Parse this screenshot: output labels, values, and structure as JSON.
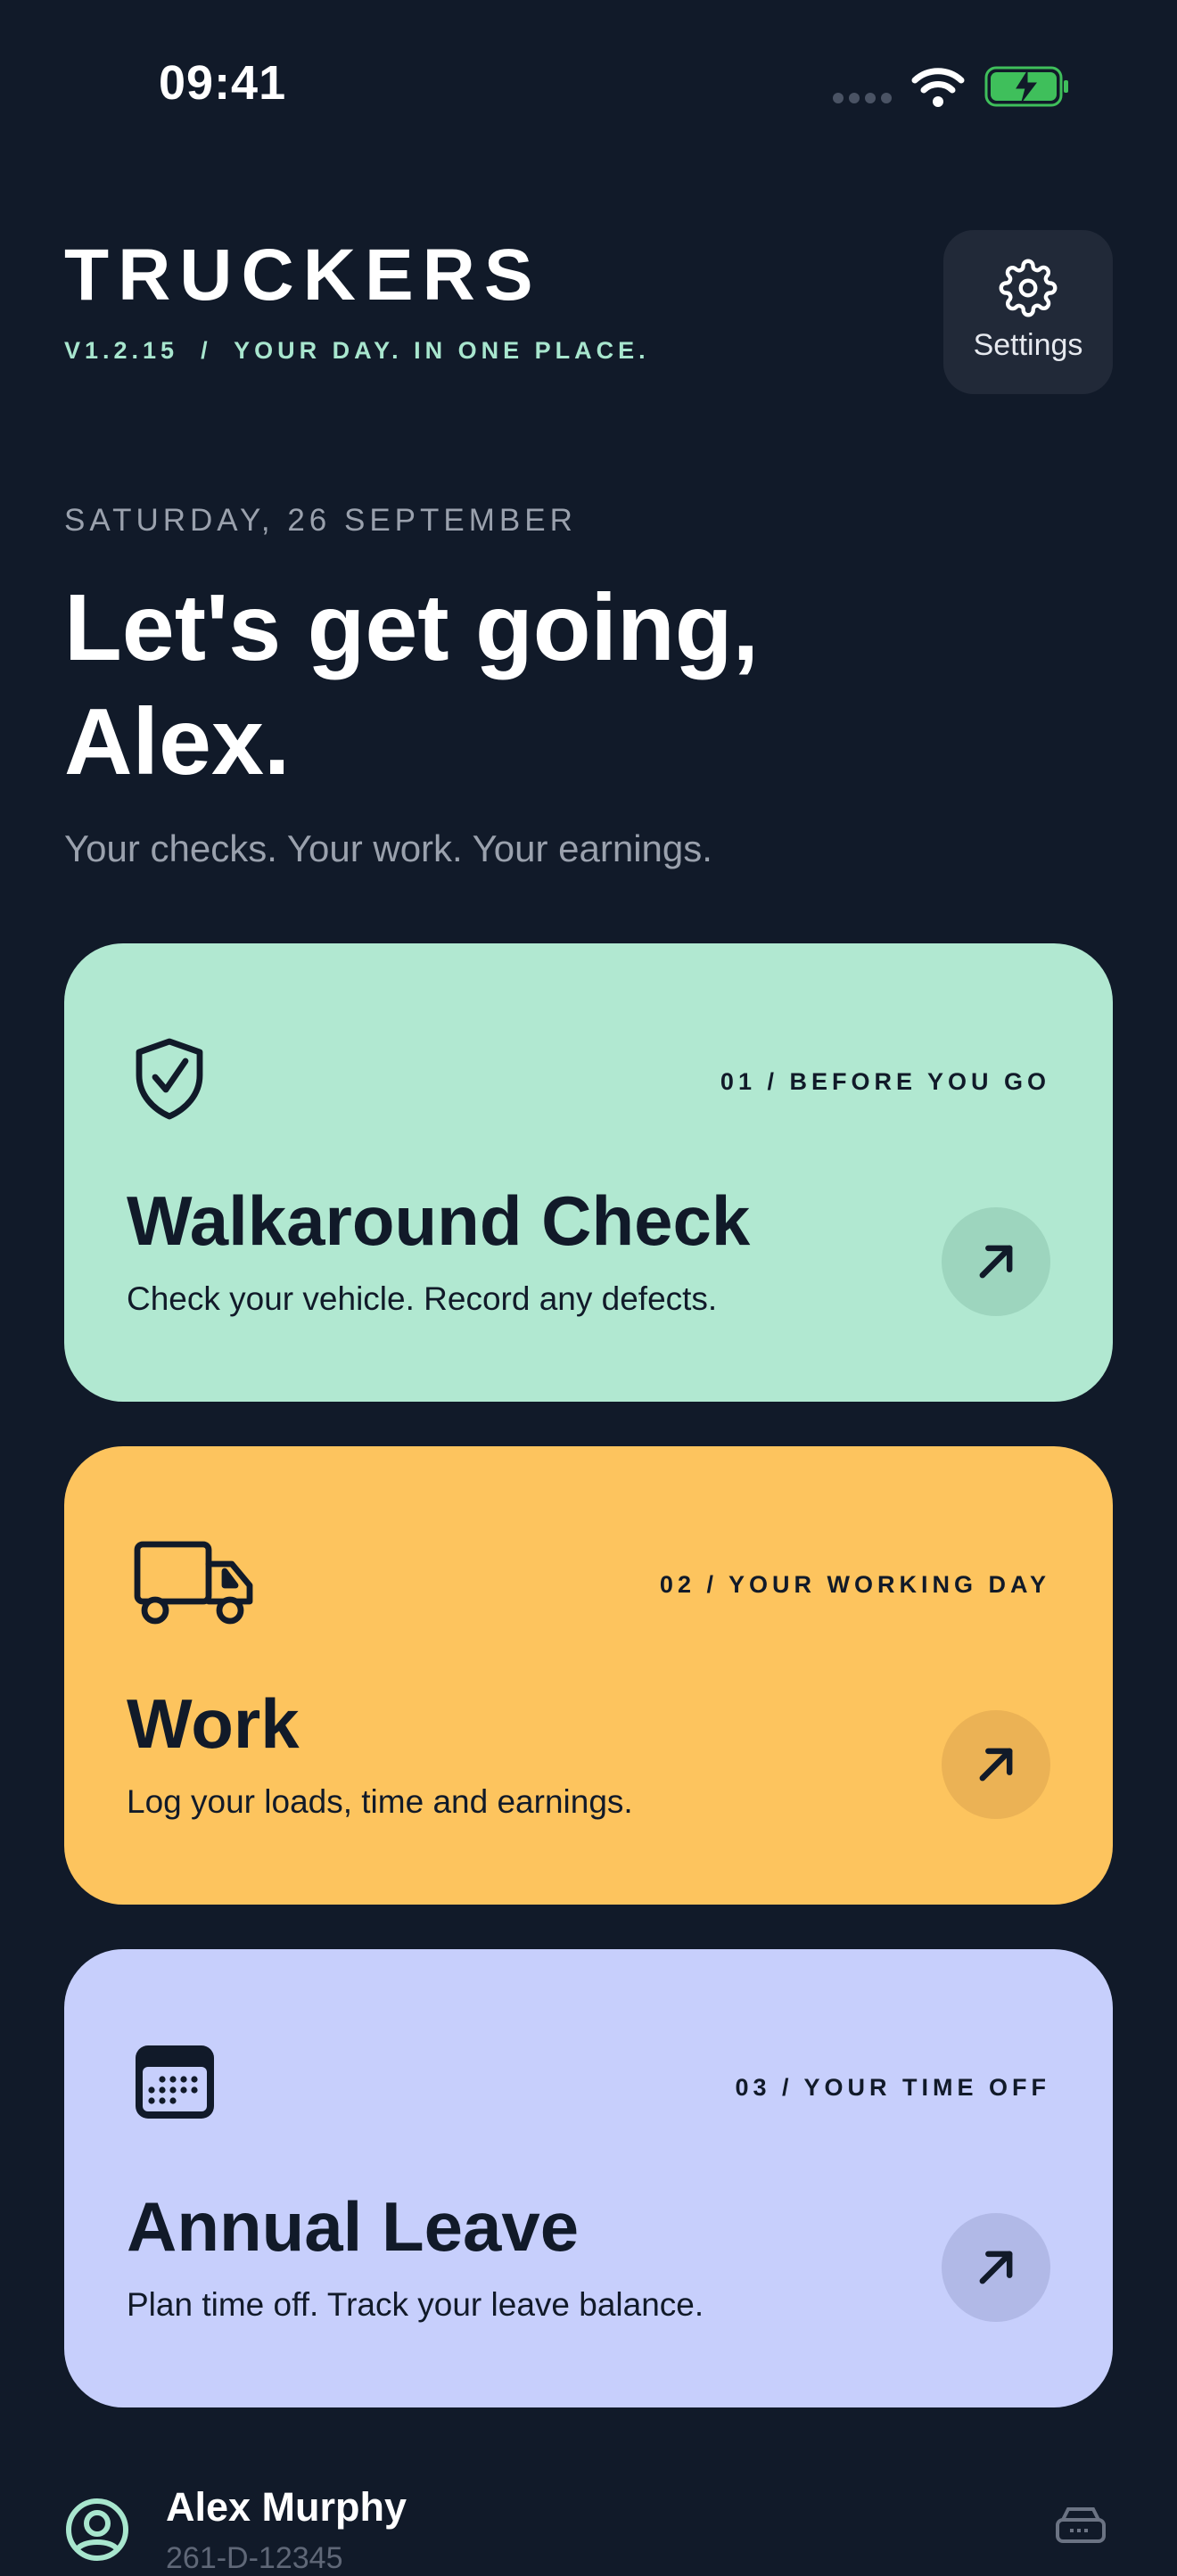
{
  "status_bar": {
    "time": "09:41",
    "icons": [
      "cellular-signal-icon",
      "wifi-icon",
      "battery-charging-icon"
    ]
  },
  "header": {
    "app_name": "TRUCKERS",
    "tagline": "V1.2.15  /  YOUR DAY. IN ONE PLACE.",
    "settings_label": "Settings",
    "settings_icon": "gear-icon"
  },
  "greeting": {
    "date": "SATURDAY, 26 SEPTEMBER",
    "headline": "Let's get going, Alex.",
    "subtitle": "Your checks. Your work. Your earnings."
  },
  "cards": [
    {
      "step": "01 / BEFORE YOU GO",
      "title": "Walkaround Check",
      "description": "Check your vehicle. Record any defects.",
      "icon": "shield-check-icon",
      "color": "#b1e8d1"
    },
    {
      "step": "02 / YOUR WORKING DAY",
      "title": "Work",
      "description": "Log your loads, time and earnings.",
      "icon": "truck-icon",
      "color": "#fdc45e"
    },
    {
      "step": "03 / YOUR TIME OFF",
      "title": "Annual Leave",
      "description": "Plan time off. Track your leave balance.",
      "icon": "calendar-icon",
      "color": "#c7cffc"
    }
  ],
  "footer": {
    "user_name": "Alex Murphy",
    "user_id": "261-D-12345",
    "icons": [
      "user-circle-icon",
      "vehicle-icon"
    ]
  },
  "colors": {
    "background": "#111a29",
    "accent": "#a8e6ce",
    "muted_text": "#9aa1ad",
    "battery_green": "#3fbf5b"
  }
}
